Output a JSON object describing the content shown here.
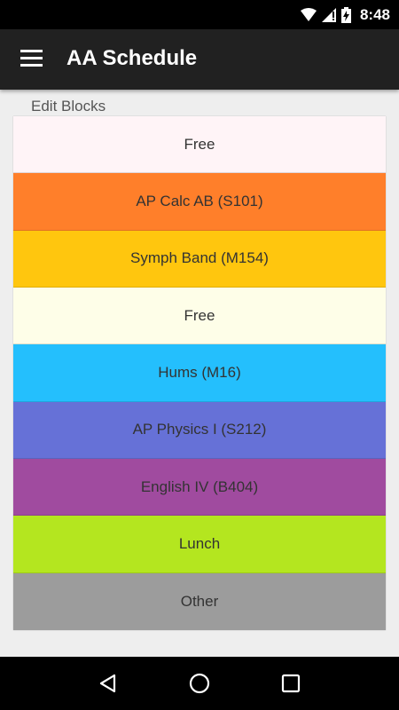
{
  "status_bar": {
    "time": "8:48",
    "icons": [
      "wifi-icon",
      "signal-icon",
      "battery-charging-icon"
    ]
  },
  "app_bar": {
    "title": "AA Schedule",
    "menu_icon": "hamburger-menu-icon"
  },
  "section_label": "Edit Blocks",
  "blocks": [
    {
      "label": "Free",
      "color": "#fff4f7"
    },
    {
      "label": "AP Calc AB (S101)",
      "color": "#ff7f2a"
    },
    {
      "label": "Symph Band (M154)",
      "color": "#ffc60e"
    },
    {
      "label": "Free",
      "color": "#fefee8"
    },
    {
      "label": "Hums (M16)",
      "color": "#24bffd"
    },
    {
      "label": "AP Physics I (S212)",
      "color": "#6671d7"
    },
    {
      "label": "English IV (B404)",
      "color": "#a04b9f"
    },
    {
      "label": "Lunch",
      "color": "#b4e61f"
    },
    {
      "label": "Other",
      "color": "#9c9c9c"
    }
  ],
  "nav_bar": {
    "icons": [
      "back-icon",
      "home-icon",
      "recents-icon"
    ]
  }
}
